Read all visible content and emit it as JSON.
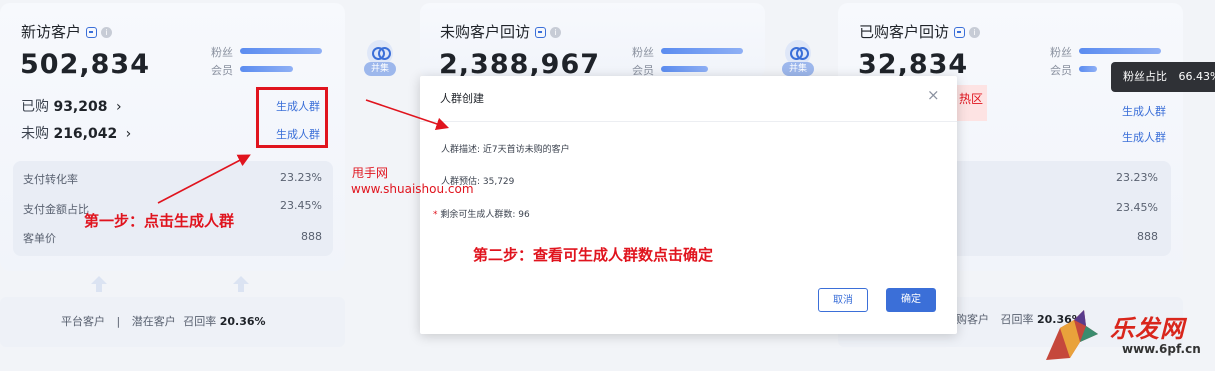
{
  "colors": {
    "accent": "#3b6fd8",
    "annotation": "#e0141e",
    "tooltip_bg": "#2f3136"
  },
  "card1": {
    "title": "新访客户",
    "value": "502,834",
    "legend": [
      "粉丝",
      "会员"
    ],
    "bars": [
      0.95,
      0.62
    ],
    "purchased_label": "已购",
    "purchased_value": "93,208",
    "unpurchased_label": "未购",
    "unpurchased_value": "216,042",
    "chevron": "›",
    "create_links": [
      "生成人群",
      "生成人群"
    ],
    "stats": [
      {
        "label": "支付转化率",
        "value": "23.23%"
      },
      {
        "label": "支付金额占比",
        "value": "23.45%"
      },
      {
        "label": "客单价",
        "value": "888"
      }
    ]
  },
  "card2": {
    "title": "未购客户回访",
    "value": "2,388,967",
    "legend": [
      "粉丝",
      "会员"
    ],
    "bars": [
      0.95,
      0.55
    ]
  },
  "card3": {
    "title": "已购客户回访",
    "value": "32,834",
    "legend": [
      "粉丝",
      "会员"
    ],
    "bars": [
      0.95,
      0.2
    ],
    "hot_label": "热区",
    "create_links": [
      "生成人群",
      "生成人群"
    ],
    "stats_values": [
      "23.23%",
      "23.45%",
      "888"
    ]
  },
  "union_label": "并集",
  "tooltip": {
    "label": "粉丝占比",
    "value": "66.43%"
  },
  "bottom": {
    "left_parts": [
      "平台客户",
      "|",
      "潜在客户",
      "召回率"
    ],
    "left_rate": "20.36%",
    "right_parts": [
      "购客户",
      "召回率"
    ],
    "right_rate": "20.36%"
  },
  "modal": {
    "title": "人群创建",
    "close": "×",
    "desc": "人群描述: 近7天首访未购的客户",
    "estimate": "人群预估: 35,729",
    "remaining_mark": "*",
    "remaining": "剩余可生成人群数: 96",
    "cancel": "取消",
    "confirm": "确定"
  },
  "annotations": {
    "step1": "第一步：点击生成人群",
    "step2": "第二步：查看可生成人群数点击确定",
    "site_name": "甩手网",
    "site_url": "www.shuaishou.com"
  },
  "watermark": {
    "brand": "乐发网",
    "url": "www.6pf.cn"
  }
}
